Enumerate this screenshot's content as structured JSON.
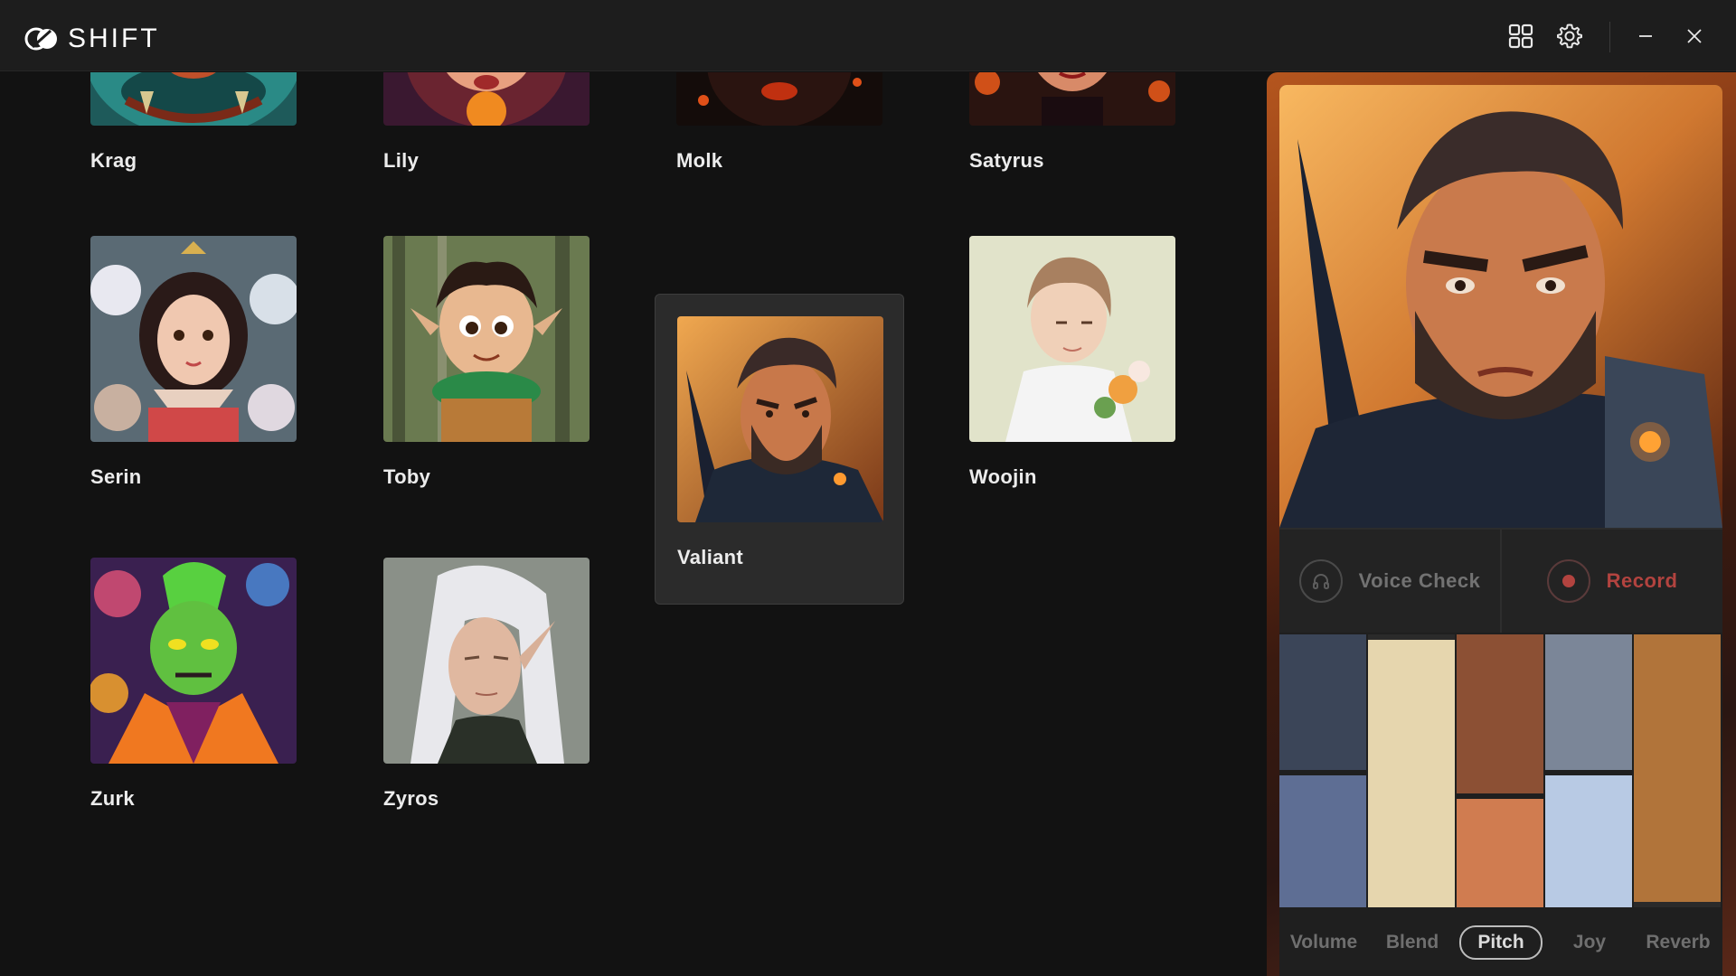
{
  "app": {
    "name": "SHIFT"
  },
  "titlebar": {
    "grid_icon": "grid-icon",
    "settings_icon": "gear-icon",
    "minimize_icon": "minimize-icon",
    "close_icon": "close-icon"
  },
  "characters": [
    {
      "name": "Krag"
    },
    {
      "name": "Lily"
    },
    {
      "name": "Molk"
    },
    {
      "name": "Satyrus"
    },
    {
      "name": "Serin"
    },
    {
      "name": "Toby"
    },
    {
      "name": "Valiant",
      "selected": true
    },
    {
      "name": "Woojin"
    },
    {
      "name": "Zurk"
    },
    {
      "name": "Zyros"
    }
  ],
  "panel": {
    "voice_check_label": "Voice Check",
    "record_label": "Record",
    "controls": [
      "Volume",
      "Blend",
      "Pitch",
      "Joy",
      "Reverb"
    ],
    "active_control": "Pitch",
    "bar_levels": [
      0.5,
      0.98,
      0.59,
      0.5,
      0.98
    ],
    "colors": {
      "accent_record": "#b2433f",
      "volume_top": "#3b4558",
      "volume_bottom": "#5e6e94",
      "blend": "#e6d6ae",
      "pitch_top": "#8c5034",
      "pitch_bottom": "#d07c50",
      "joy_top": "#7b8698",
      "joy_bottom": "#b8cae4",
      "reverb": "#b1743a"
    }
  }
}
